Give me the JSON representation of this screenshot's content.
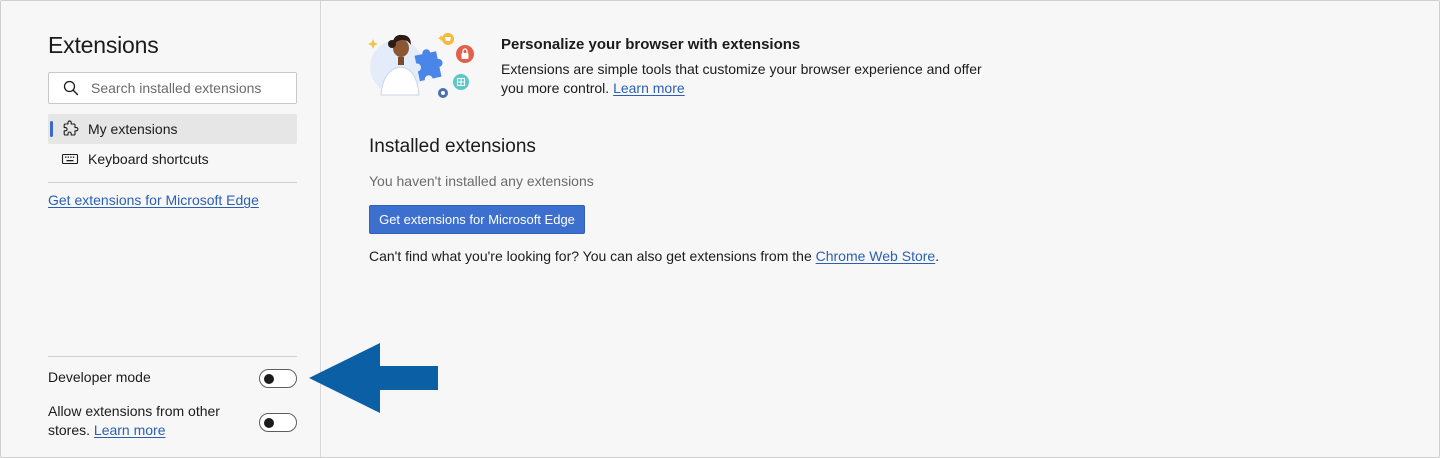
{
  "sidebar": {
    "title": "Extensions",
    "search": {
      "placeholder": "Search installed extensions",
      "value": "",
      "icon": "search-icon"
    },
    "nav": [
      {
        "label": "My extensions",
        "icon": "puzzle-icon",
        "active": true
      },
      {
        "label": "Keyboard shortcuts",
        "icon": "keyboard-icon",
        "active": false
      }
    ],
    "get_extensions_link": "Get extensions for Microsoft Edge",
    "developer_mode": {
      "label": "Developer mode",
      "on": false
    },
    "other_stores": {
      "label": "Allow extensions from other stores.",
      "link": "Learn more",
      "on": false
    }
  },
  "main": {
    "hero": {
      "title": "Personalize your browser with extensions",
      "description": "Extensions are simple tools that customize your browser experience and offer you more control.",
      "learn_more": "Learn more"
    },
    "installed": {
      "title": "Installed extensions",
      "empty_text": "You haven't installed any extensions",
      "button_label": "Get extensions for Microsoft Edge",
      "cant_find_prefix": "Can't find what you're looking for? You can also get extensions from the",
      "cant_find_link": "Chrome Web Store",
      "cant_find_suffix": "."
    }
  },
  "annotation": {
    "arrow_color": "#0b5fa5",
    "points_to": "Developer mode"
  },
  "colors": {
    "accent": "#3d6fcf",
    "link": "#2b5fb3",
    "background": "#f7f7f7"
  }
}
